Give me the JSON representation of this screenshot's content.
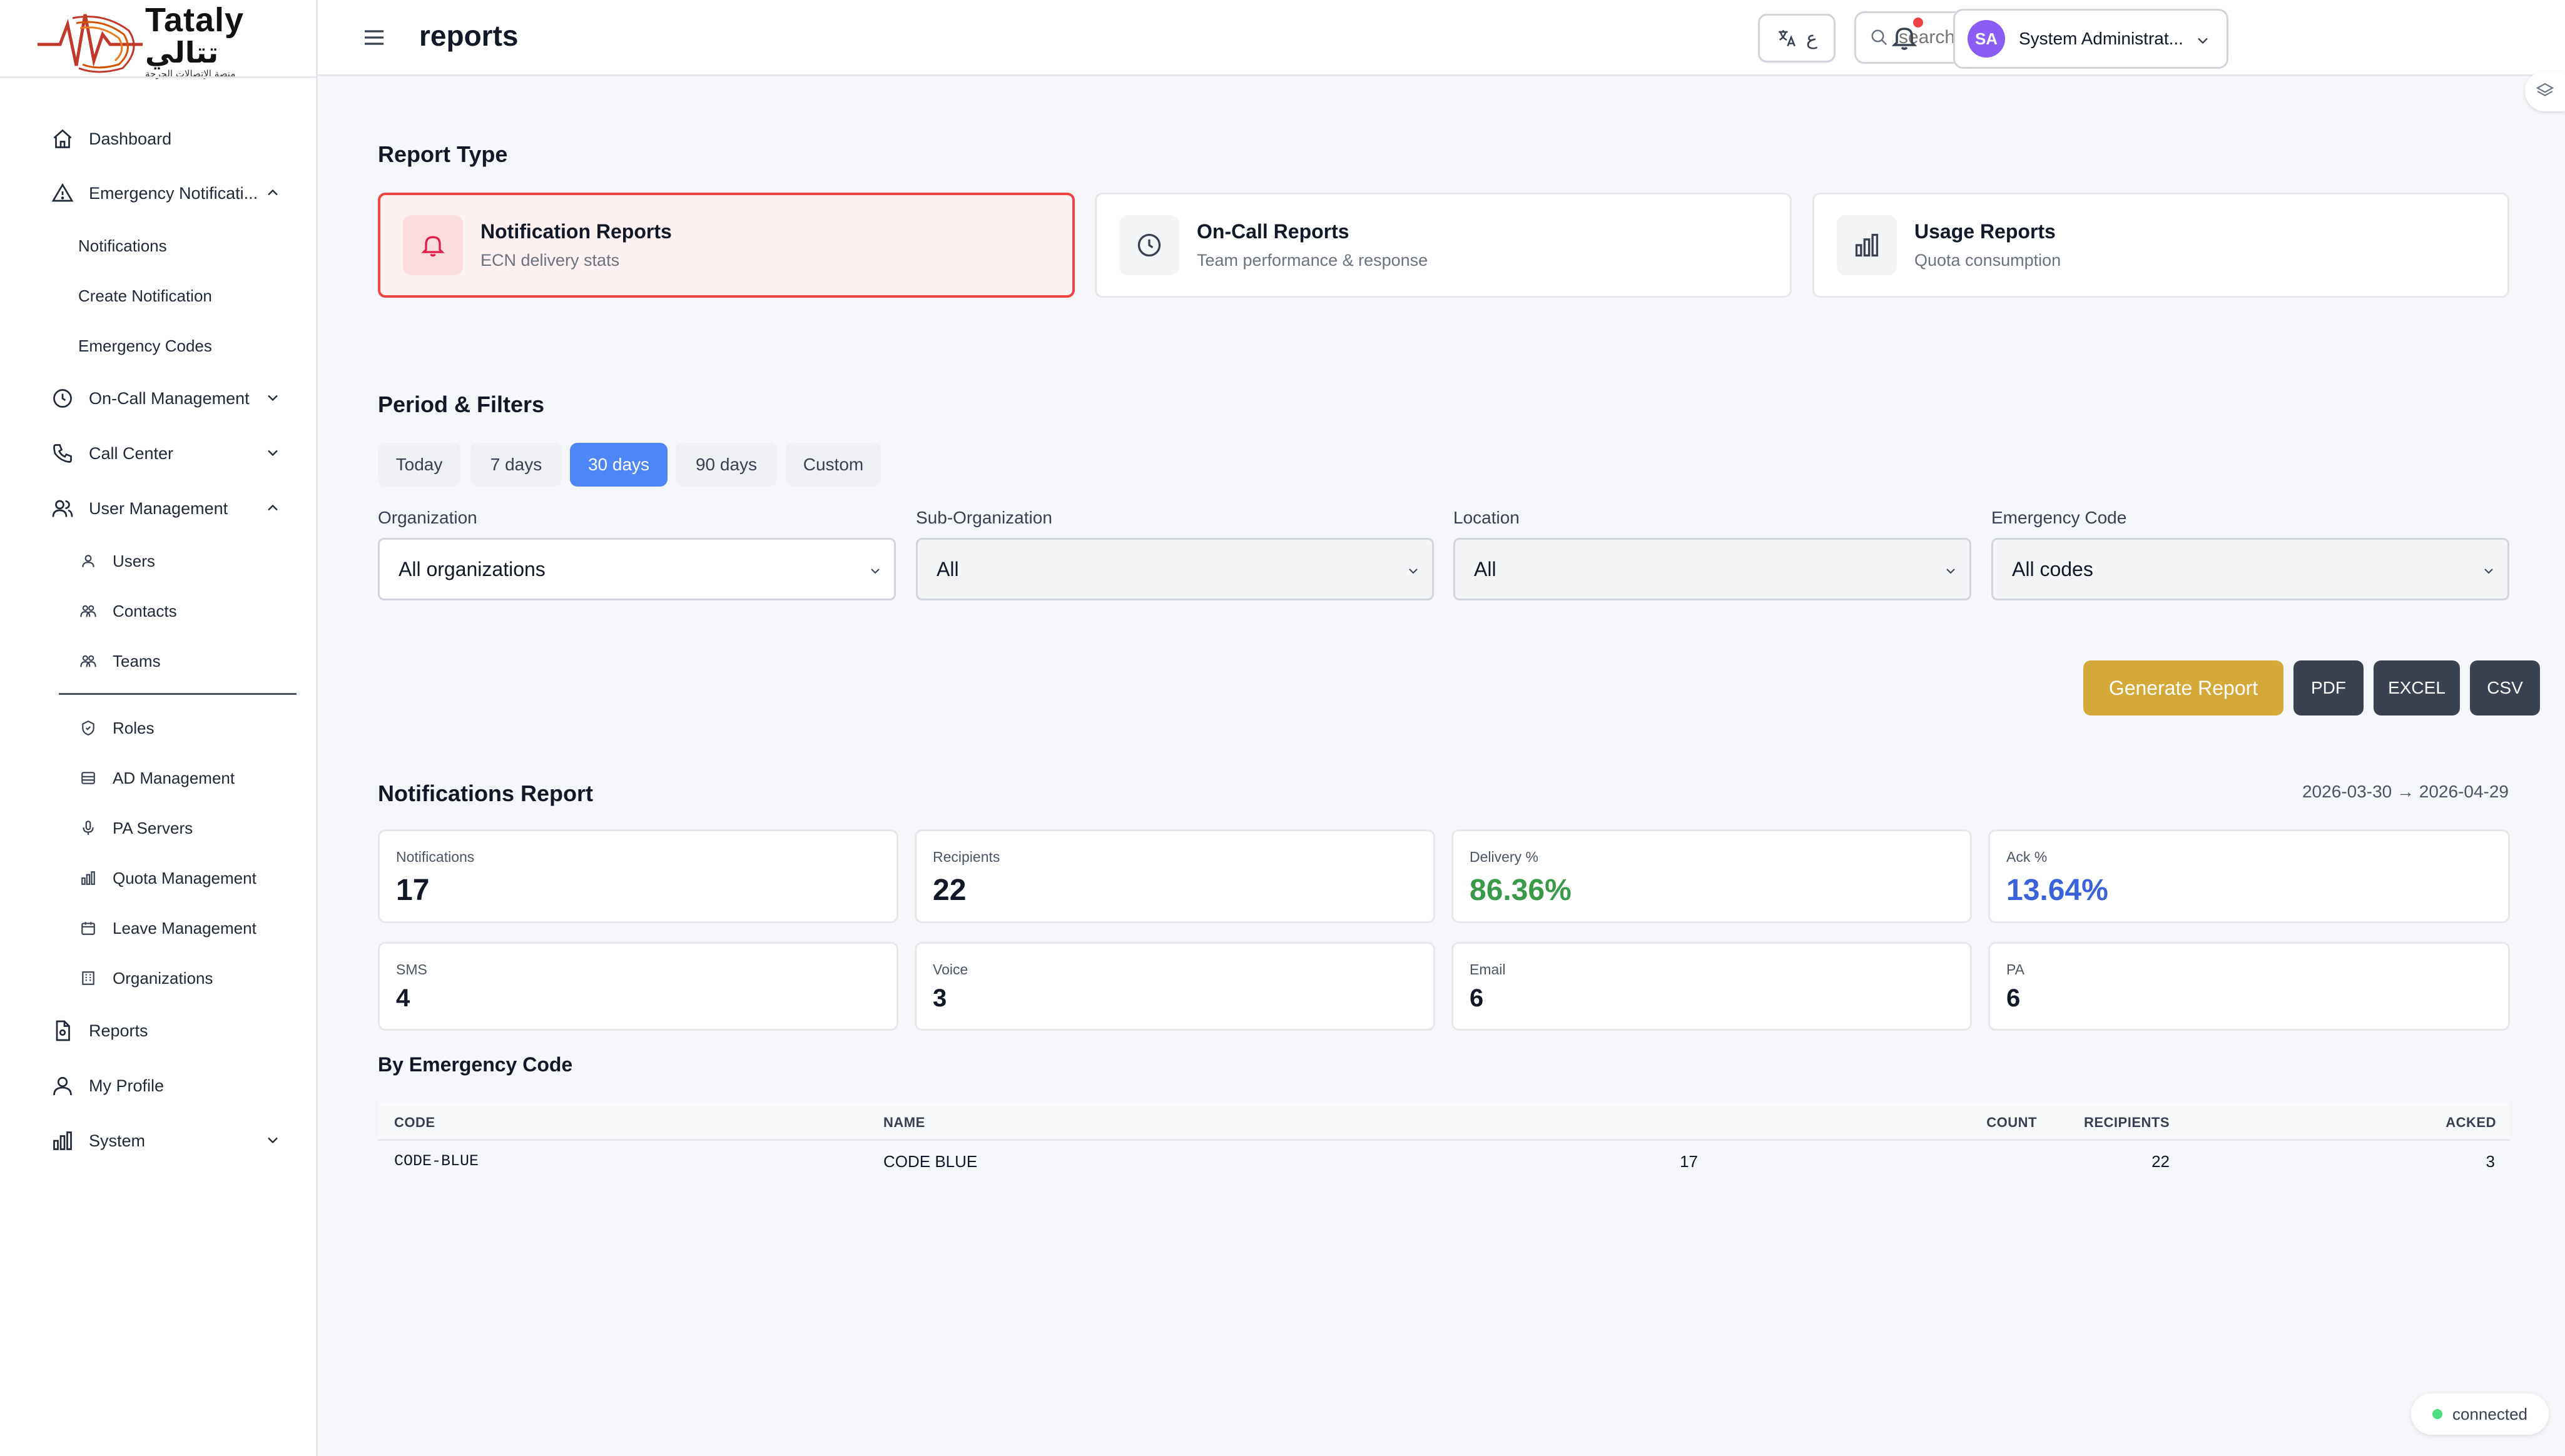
{
  "brand": {
    "name_en": "Tataly",
    "name_ar": "تتالي",
    "tagline_ar": "منصة الإتصالات الحرجة"
  },
  "sidebar": {
    "items": [
      {
        "label": "Dashboard",
        "icon": "home-icon"
      },
      {
        "label": "Emergency Notificati...",
        "icon": "warning-icon",
        "expanded": true
      },
      {
        "label": "Notifications"
      },
      {
        "label": "Create Notification"
      },
      {
        "label": "Emergency Codes"
      },
      {
        "label": "On-Call Management",
        "icon": "clock-icon",
        "expanded": false
      },
      {
        "label": "Call Center",
        "icon": "phone-icon",
        "expanded": false
      },
      {
        "label": "User Management",
        "icon": "users-icon",
        "expanded": true
      },
      {
        "label": "Users",
        "icon": "user-icon"
      },
      {
        "label": "Contacts",
        "icon": "contacts-icon"
      },
      {
        "label": "Teams",
        "icon": "team-icon"
      },
      {
        "label": "Roles",
        "icon": "shield-icon"
      },
      {
        "label": "AD Management",
        "icon": "database-icon"
      },
      {
        "label": "PA Servers",
        "icon": "microphone-icon"
      },
      {
        "label": "Quota Management",
        "icon": "bar-chart-icon"
      },
      {
        "label": "Leave Management",
        "icon": "calendar-icon"
      },
      {
        "label": "Organizations",
        "icon": "building-icon"
      },
      {
        "label": "Reports",
        "icon": "file-icon"
      },
      {
        "label": "My Profile",
        "icon": "profile-icon"
      },
      {
        "label": "System",
        "icon": "bar-chart-icon",
        "expanded": false
      }
    ]
  },
  "header": {
    "title": "reports",
    "lang_label": "ع",
    "search_placeholder": "search",
    "user_initials": "SA",
    "user_name": "System Administrat..."
  },
  "report_type": {
    "title": "Report Type",
    "cards": [
      {
        "name": "Notification Reports",
        "desc": "ECN delivery stats",
        "icon": "bell-icon",
        "active": true
      },
      {
        "name": "On-Call Reports",
        "desc": "Team performance & response",
        "icon": "clock-icon",
        "active": false
      },
      {
        "name": "Usage Reports",
        "desc": "Quota consumption",
        "icon": "bar-chart-icon",
        "active": false
      }
    ]
  },
  "filters": {
    "title": "Period & Filters",
    "periods": [
      "Today",
      "7 days",
      "30 days",
      "90 days",
      "Custom"
    ],
    "active_period": "30 days",
    "fields": [
      {
        "label": "Organization",
        "value": "All organizations"
      },
      {
        "label": "Sub-Organization",
        "value": "All"
      },
      {
        "label": "Location",
        "value": "All"
      },
      {
        "label": "Emergency Code",
        "value": "All codes"
      }
    ]
  },
  "actions": {
    "generate": "Generate Report",
    "pdf": "PDF",
    "excel": "EXCEL",
    "csv": "CSV"
  },
  "report": {
    "title": "Notifications Report",
    "date_range": "2026-03-30 → 2026-04-29",
    "stats": [
      {
        "label": "Notifications",
        "value": "17"
      },
      {
        "label": "Recipients",
        "value": "22"
      },
      {
        "label": "Delivery %",
        "value": "86.36%"
      },
      {
        "label": "Ack %",
        "value": "13.64%"
      },
      {
        "label": "SMS",
        "value": "4"
      },
      {
        "label": "Voice",
        "value": "3"
      },
      {
        "label": "Email",
        "value": "6"
      },
      {
        "label": "PA",
        "value": "6"
      }
    ],
    "table_title": "By Emergency Code",
    "columns": [
      "CODE",
      "NAME",
      "COUNT",
      "RECIPIENTS",
      "ACKED"
    ],
    "rows": [
      [
        "CODE-BLUE",
        "CODE BLUE",
        "17",
        "22",
        "3"
      ]
    ]
  },
  "status": {
    "label": "connected"
  },
  "colors": {
    "accent_red": "#ef4444",
    "primary_blue": "#4f86f7",
    "gold": "#d4a93a",
    "dark_button": "#3a4151",
    "delivery_green": "#3a9a4a",
    "ack_blue": "#3b62d8"
  }
}
